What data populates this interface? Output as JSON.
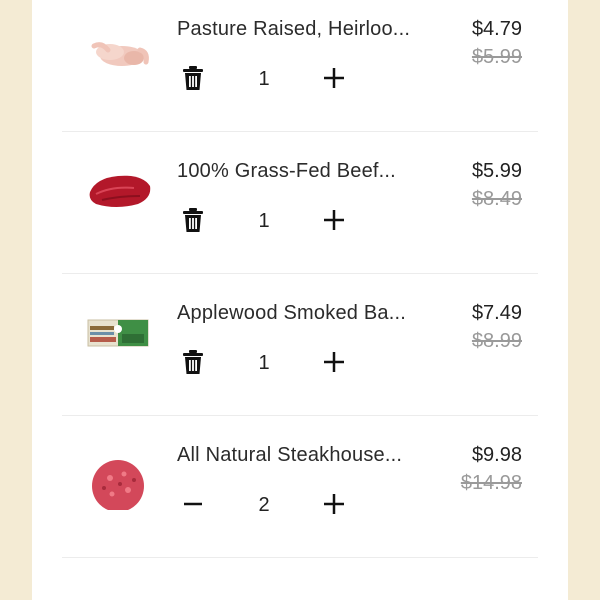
{
  "cart": {
    "items": [
      {
        "name": "Pasture Raised, Heirloo...",
        "price": "$4.79",
        "old_price": "$5.99",
        "quantity": "1",
        "left_control_icon": "trash-icon",
        "image_icon": "whole-chicken-image"
      },
      {
        "name": "100% Grass-Fed Beef...",
        "price": "$5.99",
        "old_price": "$8.49",
        "quantity": "1",
        "left_control_icon": "trash-icon",
        "image_icon": "beef-steak-image"
      },
      {
        "name": "Applewood Smoked Ba...",
        "price": "$7.49",
        "old_price": "$8.99",
        "quantity": "1",
        "left_control_icon": "trash-icon",
        "image_icon": "bacon-package-image"
      },
      {
        "name": "All Natural Steakhouse...",
        "price": "$9.98",
        "old_price": "$14.98",
        "quantity": "2",
        "left_control_icon": "minus-icon",
        "image_icon": "burger-patty-image"
      }
    ]
  },
  "colors": {
    "page_background": "#f4ebd4",
    "panel_background": "#ffffff",
    "text": "#222222",
    "strike_price": "#9a9a9a"
  }
}
